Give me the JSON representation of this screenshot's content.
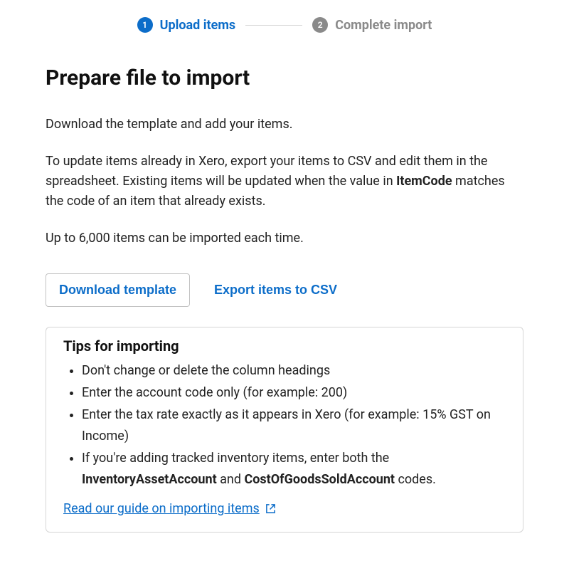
{
  "stepper": {
    "step1": {
      "num": "1",
      "label": "Upload items"
    },
    "step2": {
      "num": "2",
      "label": "Complete import"
    }
  },
  "heading": "Prepare file to import",
  "para1": "Download the template and add your items.",
  "para2_a": "To update items already in Xero, export your items to CSV and edit them in the spreadsheet. Existing items will be updated when the value in ",
  "para2_strong": "ItemCode",
  "para2_b": " matches the code of an item that already exists.",
  "para3": "Up to 6,000 items can be imported each time.",
  "buttons": {
    "download": "Download template",
    "export": "Export items to CSV"
  },
  "tips": {
    "title": "Tips for importing",
    "item1": "Don't change or delete the column headings",
    "item2": "Enter the account code only (for example: 200)",
    "item3": "Enter the tax rate exactly as it appears in Xero (for example: 15% GST on Income)",
    "item4_a": "If you're adding tracked inventory items, enter both the ",
    "item4_s1": "InventoryAssetAccount",
    "item4_mid": " and ",
    "item4_s2": "CostOfGoodsSoldAccount",
    "item4_b": " codes.",
    "guide": "Read our guide on importing items"
  }
}
